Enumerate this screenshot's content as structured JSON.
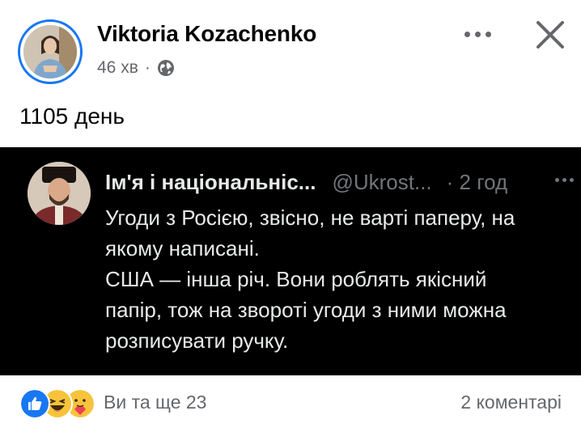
{
  "post": {
    "author": "Viktoria Kozachenko",
    "time": "46 хв",
    "separator": "·",
    "privacy_icon": "globe-icon",
    "text": "1105 день"
  },
  "header_actions": {
    "more_icon": "more-horizontal-icon",
    "close_icon": "close-icon"
  },
  "tweet": {
    "name": "Ім'я і національніс...",
    "handle": "@Ukrost...",
    "time": "· 2 год",
    "lines": [
      "Угоди з Росією, звісно, не варті паперу, на",
      "якому написані.",
      "США — інша річ. Вони роблять якісний",
      "папір, тож на звороті угоди з ними можна",
      "розписувати ручку."
    ]
  },
  "footer": {
    "reactions": [
      "like-icon",
      "haha-icon",
      "care-icon"
    ],
    "reactions_text": "Ви та ще 23",
    "comments": "2 коментарі"
  },
  "colors": {
    "accent": "#1877f2",
    "secondary_text": "#65676b",
    "tweet_bg": "#000000",
    "tweet_text": "#e7e9ea",
    "tweet_muted": "#71767b"
  }
}
